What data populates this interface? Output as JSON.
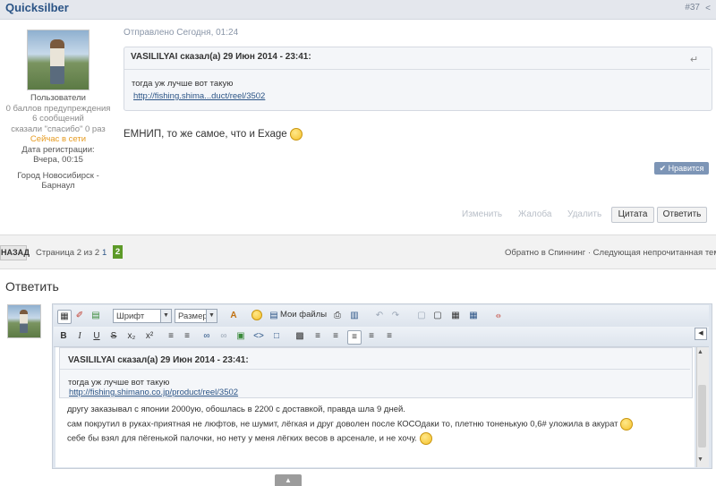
{
  "post": {
    "author": "Quicksilber",
    "number": "#37",
    "share_icon": "share-icon",
    "posted": "Отправлено Сегодня, 01:24",
    "author_info": {
      "group": "Пользователи",
      "warnings": "0 баллов предупреждения",
      "posts": "6 сообщений",
      "thanks": "сказали \"спасибо\" 0 раз",
      "online": "Сейчас в сети",
      "reg_label": "Дата регистрации:",
      "reg_date": "Вчера, 00:15",
      "city_line1": "Город Новосибирск -",
      "city_line2": "Барнаул"
    },
    "quote": {
      "title": "VASILILYAI сказал(а) 29 Июн 2014 - 23:41:",
      "text": "тогда уж лучше вот такую",
      "link": "http://fishing.shima...duct/reel/3502"
    },
    "text": "ЕМНИП, то же самое, что и Exage",
    "like_label": "Нравится",
    "actions": {
      "edit": "Изменить",
      "report": "Жалоба",
      "delete": "Удалить",
      "quote": "Цитата",
      "reply": "Ответить"
    }
  },
  "pagination": {
    "back": "НАЗАД",
    "page_of": "Страница 2 из 2",
    "pages": [
      "1",
      "2"
    ],
    "current": "2",
    "right": "Обратно в Спиннинг · Следующая непрочитанная тема"
  },
  "reply": {
    "title": "Ответить",
    "toolbar": {
      "font": "Шрифт",
      "size": "Размер",
      "my_files": "Мои файлы"
    },
    "quote": {
      "title": "VASILILYAI сказал(а) 29 Июн 2014 - 23:41:",
      "text": "тогда уж лучше вот такую",
      "link": "http://fishing.shimano.co.jp/product/reel/3502"
    },
    "lines": [
      "другу заказывал с японии 2000ую, обошлась в 2200 с доставкой, правда шла 9 дней.",
      "сам покрутил в руках-приятная не люфтов, не шумит, лёгкая и друг доволен после КОСОдаки то, плетню тоненькую 0,6# уложила в акурат",
      "себе бы взял для пёгенькой палочки, но нету у меня лёгких весов в арсенале, и не хочу."
    ]
  },
  "colors": {
    "header_bg": "#e4e7ed",
    "author": "#2b5486",
    "online": "#e69a1f",
    "current_page": "#5d9a28",
    "like_button": "#7d95b6"
  }
}
